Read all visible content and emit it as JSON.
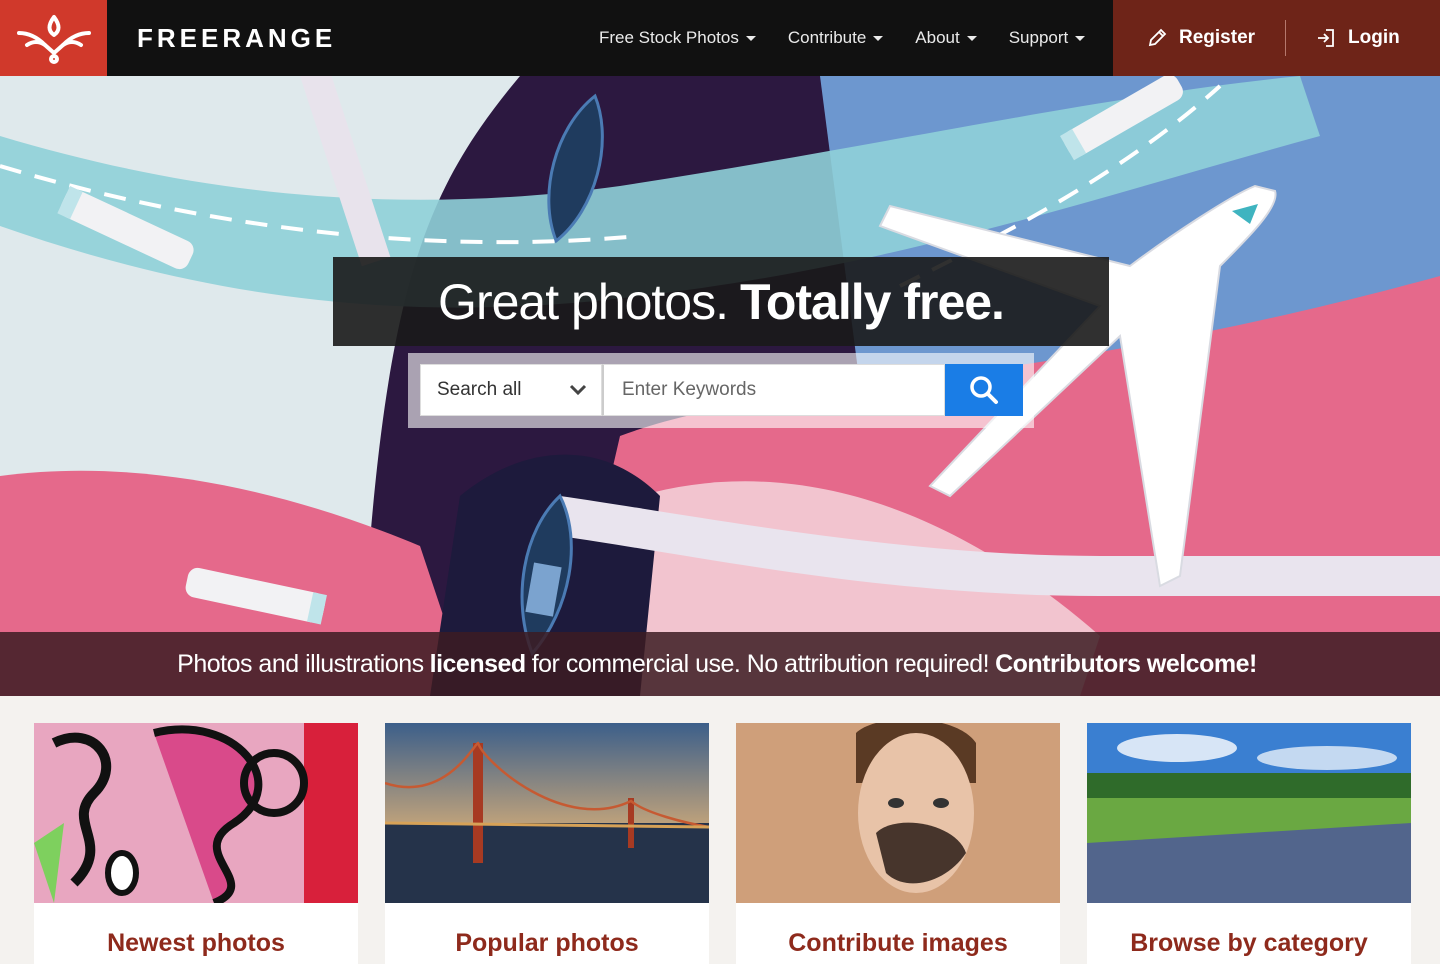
{
  "brand": {
    "name": "FREERANGE",
    "logo_color": "#d0392b"
  },
  "nav": {
    "items": [
      {
        "label": "Free Stock Photos"
      },
      {
        "label": "Contribute"
      },
      {
        "label": "About"
      },
      {
        "label": "Support"
      }
    ],
    "register_label": "Register",
    "login_label": "Login"
  },
  "hero": {
    "headline_light": "Great photos.",
    "headline_bold": "Totally free.",
    "search_scope": "Search all",
    "search_placeholder": "Enter Keywords",
    "search_button_color": "#1a7de6"
  },
  "tagline": {
    "part1": "Photos and illustrations",
    "bold1": "licensed",
    "part2": "for commercial use. No attribution required!",
    "bold2": "Contributors welcome!"
  },
  "cards": [
    {
      "title": "Newest photos",
      "icon": "graffiti-image"
    },
    {
      "title": "Popular photos",
      "icon": "bridge-image"
    },
    {
      "title": "Contribute images",
      "icon": "portrait-image"
    },
    {
      "title": "Browse by category",
      "icon": "meadow-image"
    }
  ]
}
